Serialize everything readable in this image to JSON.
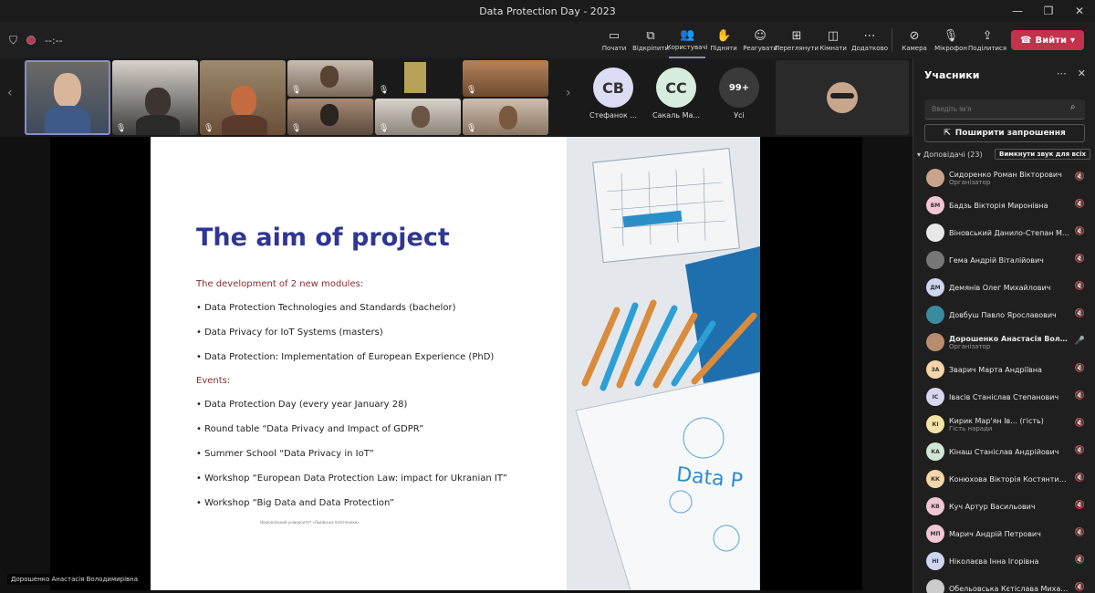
{
  "window": {
    "title": "Data Protection Day - 2023"
  },
  "toolbar": {
    "timer": "--:--",
    "items": [
      {
        "label": "Почати",
        "icon": "screen-share-icon",
        "glyph": "▭"
      },
      {
        "label": "Відкріпити",
        "icon": "unpin-icon",
        "glyph": "⧉"
      },
      {
        "label": "Користувачі",
        "icon": "people-icon",
        "glyph": "👥"
      },
      {
        "label": "Підняти",
        "icon": "raise-hand-icon",
        "glyph": "✋"
      },
      {
        "label": "Реагувати",
        "icon": "react-icon",
        "glyph": "☺"
      },
      {
        "label": "Переглянути",
        "icon": "view-icon",
        "glyph": "⊞"
      },
      {
        "label": "Кімнати",
        "icon": "rooms-icon",
        "glyph": "◫"
      },
      {
        "label": "Додатково",
        "icon": "more-icon",
        "glyph": "⋯"
      }
    ],
    "camera_label": "Камера",
    "mic_label": "Мікрофон",
    "share_label": "Поділитися",
    "leave_label": "Вийти"
  },
  "strip": {
    "avatars": [
      {
        "initials": "СВ",
        "name": "Стефанок ...",
        "color": "#dcdcf5"
      },
      {
        "initials": "СС",
        "name": "Сакаль Ма...",
        "color": "#d6eddf"
      },
      {
        "initials": "99+",
        "name": "Усі",
        "color": "#3a3a3a"
      }
    ]
  },
  "slide": {
    "title": "The aim of project",
    "modules_heading": "The development of 2 new modules:",
    "modules": [
      "• Data Protection Technologies and Standards (bachelor)",
      "• Data Privacy for IoT Systems (masters)",
      "• Data Protection: Implementation of European Experience (PhD)"
    ],
    "events_heading": "Events:",
    "events": [
      "• Data Protection Day (every year January 28)",
      "• Round table “Data Privacy and Impact of GDPR”",
      "• Summer School “Data Privacy in IoT”",
      "• Workshop “European Data Protection Law: impact for Ukranian IT”",
      "• Workshop “Big Data and Data Protection”"
    ],
    "footer": "Національний університет «Львівська політехніка»",
    "photo_text": "Data P"
  },
  "presenter": {
    "name": "Дорошенко Анастасія Володимирівна"
  },
  "panel": {
    "title": "Учасники",
    "search_placeholder": "Введіть ім'я",
    "invite_label": "Поширити запрошення",
    "section_label": "Доповідачі (23)",
    "mute_all_label": "Вимкнути звук для всіх",
    "participants": [
      {
        "initials": "",
        "name": "Сидоренко Роман Вікторович",
        "role": "Організатор",
        "color": "#c9a38a",
        "mic": "off"
      },
      {
        "initials": "БМ",
        "name": "Бадзь Вікторія Миронівна",
        "role": "",
        "color": "#f3c6d5",
        "mic": "off"
      },
      {
        "initials": "",
        "name": "Віновський Данило-Степан Ми...",
        "role": "",
        "color": "#e8e8e8",
        "mic": "off"
      },
      {
        "initials": "",
        "name": "Гема Андрій Віталійович",
        "role": "",
        "color": "#777777",
        "mic": "off"
      },
      {
        "initials": "ДМ",
        "name": "Демянів Олег Михайлович",
        "role": "",
        "color": "#cfd6f2",
        "mic": "off"
      },
      {
        "initials": "",
        "name": "Довбуш Павло Ярославович",
        "role": "",
        "color": "#3a8aa0",
        "mic": "off"
      },
      {
        "initials": "",
        "name": "Дорошенко Анастасія Володи...",
        "role": "Організатор",
        "color": "#b88c70",
        "mic": "on"
      },
      {
        "initials": "ЗА",
        "name": "Зварич Марта Андріївна",
        "role": "",
        "color": "#f6d6a8",
        "mic": "off"
      },
      {
        "initials": "ІС",
        "name": "Івасів Станіслав Степанович",
        "role": "",
        "color": "#d8d6f0",
        "mic": "off"
      },
      {
        "initials": "КІ",
        "name": "Кирик Мар'ян Ів... (гість)",
        "role": "Гість наради",
        "color": "#f4e3a6",
        "mic": "off"
      },
      {
        "initials": "КА",
        "name": "Кінаш Станіслав Андрійович",
        "role": "",
        "color": "#cfe8d6",
        "mic": "off"
      },
      {
        "initials": "КК",
        "name": "Конюхова Вікторія Костянтинів...",
        "role": "",
        "color": "#f6d6a8",
        "mic": "off"
      },
      {
        "initials": "КВ",
        "name": "Куч Артур Васильович",
        "role": "",
        "color": "#f3c6d5",
        "mic": "off"
      },
      {
        "initials": "МП",
        "name": "Марич Андрій Петрович",
        "role": "",
        "color": "#f3c6d5",
        "mic": "off"
      },
      {
        "initials": "НІ",
        "name": "Ніколаєва Інна Ігорівна",
        "role": "",
        "color": "#cfd6f2",
        "mic": "off"
      },
      {
        "initials": "",
        "name": "Обельовська Кєтіслава Михай...",
        "role": "",
        "color": "#cccccc",
        "mic": "off"
      }
    ]
  }
}
